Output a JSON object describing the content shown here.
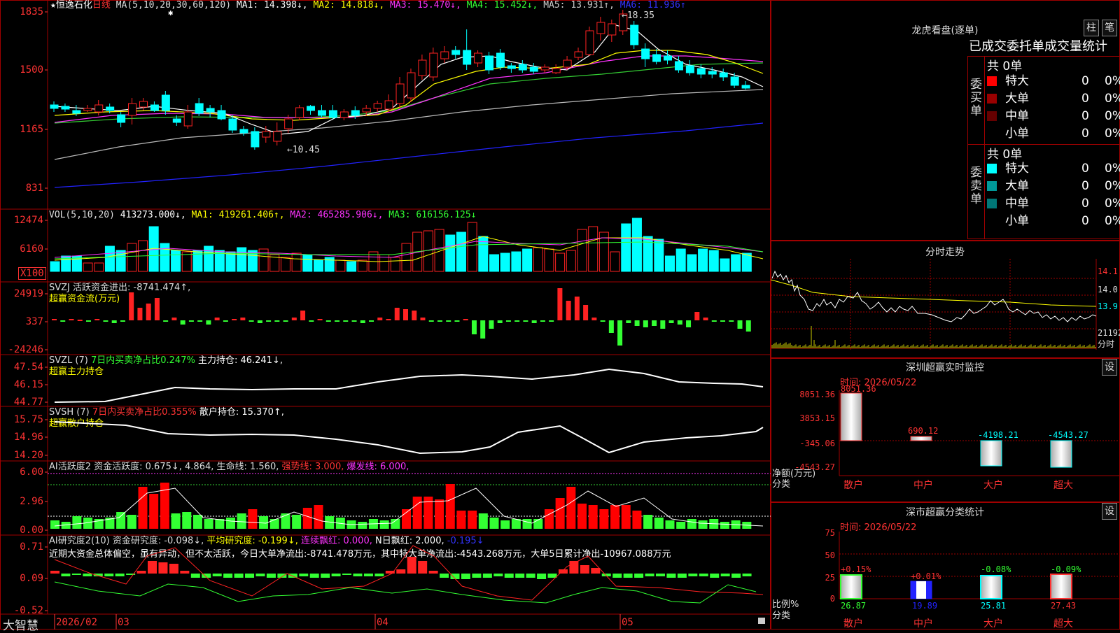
{
  "main": {
    "star": "★",
    "stock_name": "恒逸石化",
    "period": "日线",
    "ma_header": "MA(5,10,20,30,60,120)",
    "ma_values": [
      {
        "label": "MA1: 14.398↓,",
        "color": "#ffffff"
      },
      {
        "label": "MA2: 14.818↓,",
        "color": "#ffff00"
      },
      {
        "label": "MA3: 15.470↓,",
        "color": "#ff33ff"
      },
      {
        "label": "MA4: 15.452↓,",
        "color": "#33ff33"
      },
      {
        "label": "MA5: 13.931↑,",
        "color": "#cccccc"
      },
      {
        "label": "MA6: 11.936↑",
        "color": "#3333ff"
      }
    ],
    "y_ticks": [
      "1835",
      "1500",
      "1165",
      "831"
    ],
    "high_note": "←18.35",
    "low_note": "←10.45"
  },
  "vol": {
    "header": "VOL(5,10,20)",
    "value": "413273.000↓,",
    "ma1": "MA1: 419261.406↑,",
    "ma2": "MA2: 465285.906↓,",
    "ma3": "MA3: 616156.125↓",
    "y_ticks": [
      "12474",
      "6160"
    ],
    "unit": "X100"
  },
  "svzj": {
    "header": "SVZJ  活跃资金进出: -8741.474↑,",
    "subtitle": "超赢资金流(万元)",
    "y_ticks": [
      "24919",
      "337",
      "-24246"
    ]
  },
  "svzl": {
    "header_a": "SVZL (7)",
    "header_b": "7日内买卖净占比0.247%",
    "header_c": "主力持仓: 46.241↓,",
    "subtitle": "超赢主力持仓",
    "y_ticks": [
      "47.54",
      "46.15",
      "44.77"
    ]
  },
  "svsh": {
    "header_a": "SVSH (7)",
    "header_b": "7日内买卖净占比0.355%",
    "header_c": "散户持仓: 15.370↑,",
    "subtitle": "超赢散户持仓",
    "y_ticks": [
      "15.75",
      "14.96",
      "14.20"
    ]
  },
  "ai_active": {
    "header": "AI活跃度2 资金活跃度: 0.675↓, 4.864, 生命线: 1.560,",
    "strong": "强势线: 3.000,",
    "burst": "爆发线: 6.000,",
    "y_ticks": [
      "6.00",
      "2.96",
      "0.00"
    ]
  },
  "ai_research": {
    "header_a": "AI研究度2(10) 资金研究度: -0.098↓,",
    "header_b": "平均研究度: -0.199↓,",
    "header_c": "连续飘红: 0.000,",
    "header_d": "N日飘红: 2.000,",
    "header_e": "-0.195↓",
    "note": "近期大资金总体偏空，虽有异动，但不太活跃，今日大单净流出:-8741.478万元，其中特大单净流出:-4543.268万元，大单5日累计净出-10967.088万元",
    "y_ticks": [
      "0.71",
      "0.09",
      "-0.52"
    ]
  },
  "footer": {
    "brand": "大智慧",
    "dates": [
      "2026/02",
      "03",
      "04",
      "05"
    ]
  },
  "right": {
    "dragon_title": "龙虎看盘(逐单)",
    "btn_bar": "柱",
    "btn_pen": "笔",
    "tabs": [
      "已成交",
      "委托单",
      "成交量",
      "统计"
    ],
    "buy_label": "委买单",
    "sell_label": "委卖单",
    "buy_total": "共 0单",
    "sell_total": "共 0单",
    "buy_rows": [
      {
        "name": "特大",
        "count": "0",
        "pct": "0%",
        "color": "#ff0000"
      },
      {
        "name": "大单",
        "count": "0",
        "pct": "0%",
        "color": "#990000"
      },
      {
        "name": "中单",
        "count": "0",
        "pct": "0%",
        "color": "#660000"
      },
      {
        "name": "小单",
        "count": "0",
        "pct": "0%",
        "color": "#000000"
      }
    ],
    "sell_rows": [
      {
        "name": "特大",
        "count": "0",
        "pct": "0%",
        "color": "#00ffff"
      },
      {
        "name": "大单",
        "count": "0",
        "pct": "0%",
        "color": "#009999"
      },
      {
        "name": "中单",
        "count": "0",
        "pct": "0%",
        "color": "#007777"
      },
      {
        "name": "小单",
        "count": "0",
        "pct": "0%",
        "color": "#000000"
      }
    ],
    "intraday_title": "分时走势",
    "intraday_ticks": [
      "14.1",
      "14.0",
      "13.9",
      "21192",
      "分时"
    ],
    "monitor_title": "深圳超赢实时监控",
    "monitor_btn": "设",
    "monitor_time": "时间: 2026/05/22",
    "monitor_y": [
      "8051.36",
      "3853.15",
      "-345.06",
      "-4543.27"
    ],
    "monitor_bar_labels": [
      "8051.36",
      "690.12",
      "-4198.21",
      "-4543.27"
    ],
    "monitor_axis_label": "净额(万元)",
    "monitor_axis_label2": "分类",
    "monitor_cats": [
      "散户",
      "中户",
      "大户",
      "超大"
    ],
    "class_title": "深市超赢分类统计",
    "class_btn": "设",
    "class_time": "时间: 2026/05/22",
    "class_y": [
      "75",
      "50",
      "25",
      "0"
    ],
    "class_changes": [
      "+0.15%",
      "+0.01%",
      "-0.08%",
      "-0.09%"
    ],
    "class_values": [
      "26.87",
      "19.89",
      "25.81",
      "27.43"
    ],
    "class_axis_label": "比例%",
    "class_axis_label2": "分类",
    "class_cats": [
      "散户",
      "中户",
      "大户",
      "超大"
    ]
  }
}
